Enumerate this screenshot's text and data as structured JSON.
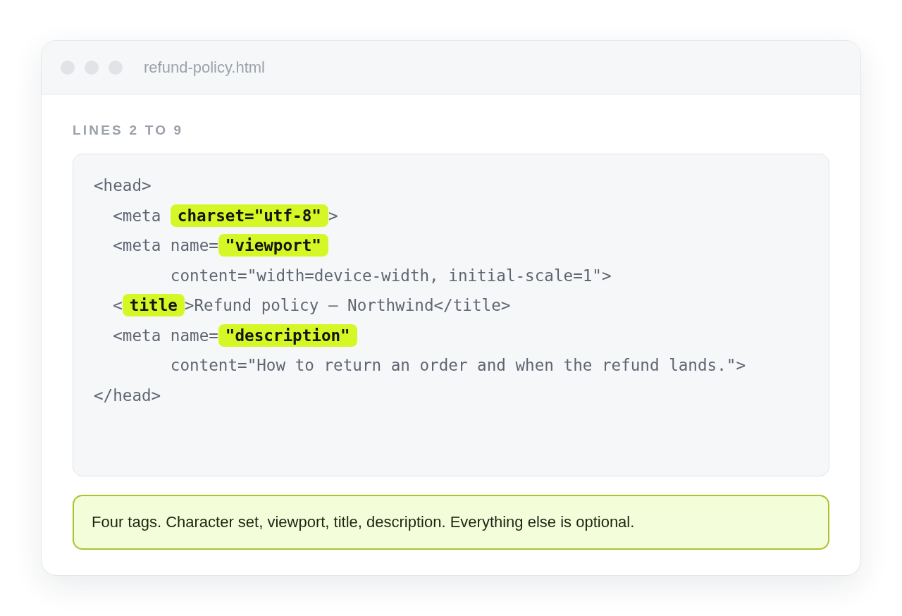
{
  "window": {
    "title": "refund-policy.html"
  },
  "section_label": "LINES 2 TO 9",
  "code": {
    "lines": [
      {
        "segments": [
          {
            "text": "<head>",
            "highlighted": false
          }
        ]
      },
      {
        "segments": [
          {
            "text": "  <meta ",
            "highlighted": false
          },
          {
            "text": "charset=\"utf-8\"",
            "highlighted": true
          },
          {
            "text": ">",
            "highlighted": false
          }
        ]
      },
      {
        "segments": [
          {
            "text": "  <meta name=",
            "highlighted": false
          },
          {
            "text": "\"viewport\"",
            "highlighted": true
          }
        ]
      },
      {
        "segments": [
          {
            "text": "        content=\"width=device-width, initial-scale=1\">",
            "highlighted": false
          }
        ]
      },
      {
        "segments": [
          {
            "text": "  <",
            "highlighted": false
          },
          {
            "text": "title",
            "highlighted": true
          },
          {
            "text": ">Refund policy — Northwind</title>",
            "highlighted": false
          }
        ]
      },
      {
        "segments": [
          {
            "text": "  <meta name=",
            "highlighted": false
          },
          {
            "text": "\"description\"",
            "highlighted": true
          }
        ]
      },
      {
        "segments": [
          {
            "text": "        content=\"How to return an order and when the refund lands.\">",
            "highlighted": false
          }
        ]
      },
      {
        "segments": [
          {
            "text": "</head>",
            "highlighted": false
          }
        ]
      }
    ]
  },
  "note": "Four tags. Character set, viewport, title, description. Everything else is optional."
}
